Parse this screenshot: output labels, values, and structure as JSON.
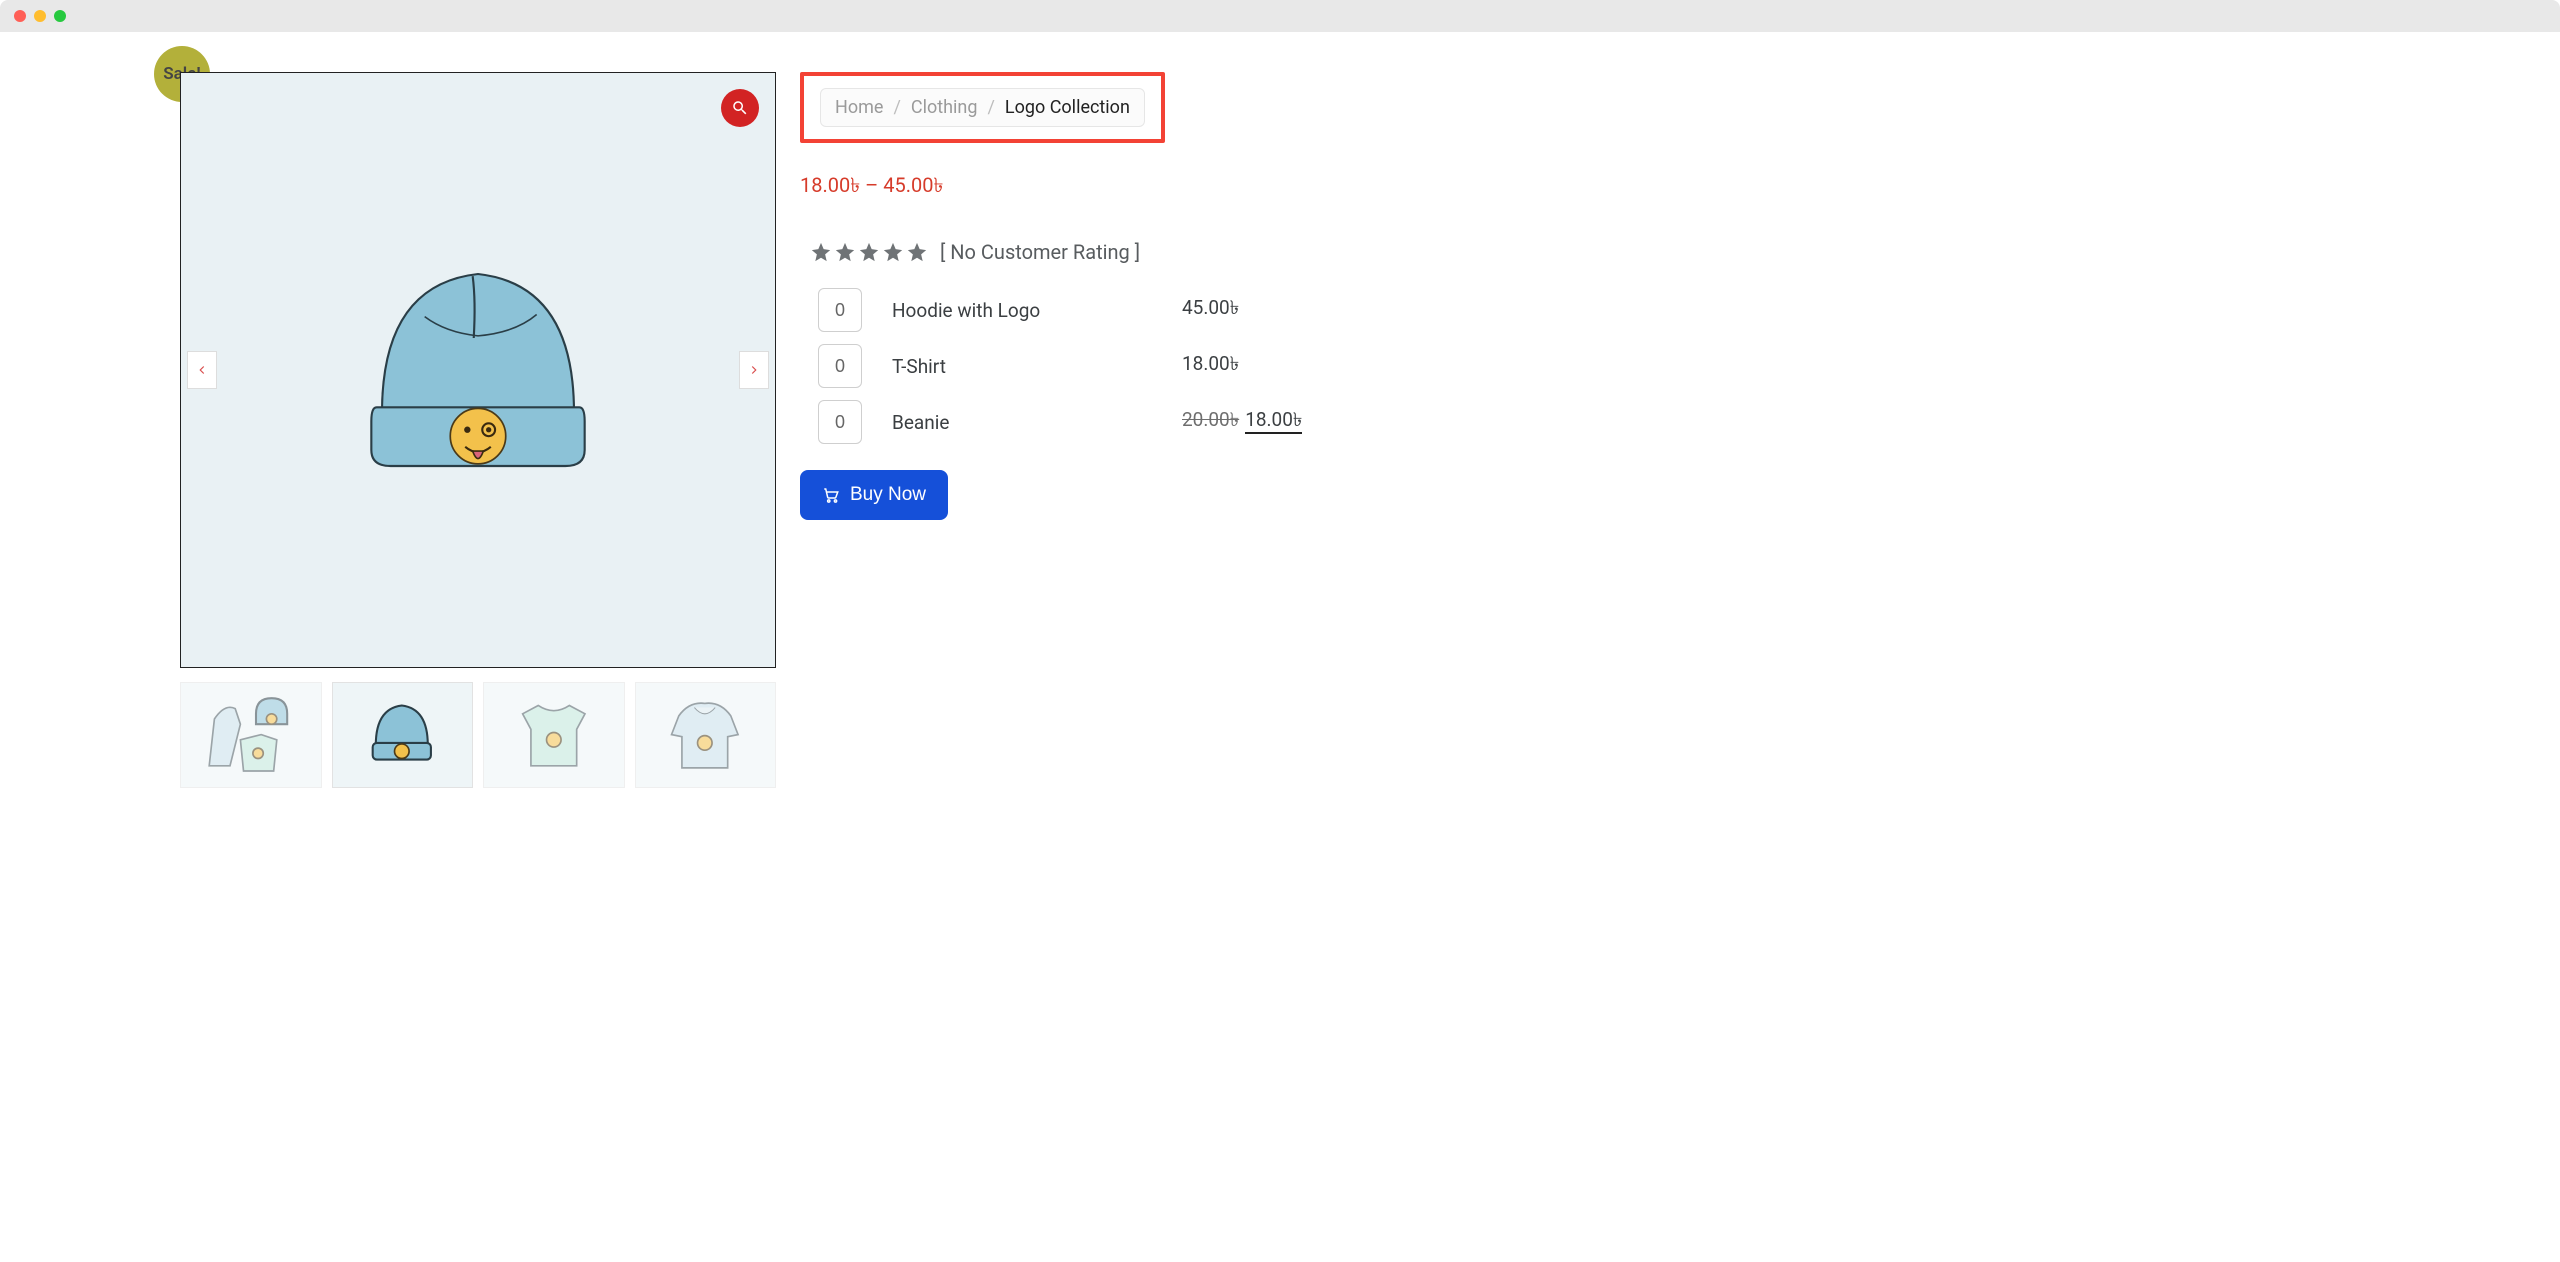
{
  "sale_badge": "Sale!",
  "breadcrumb": {
    "home": "Home",
    "clothing": "Clothing",
    "current": "Logo Collection"
  },
  "price_range": "18.00৳  – 45.00৳",
  "rating_text": "[ No Customer Rating ]",
  "variants": [
    {
      "qty": "0",
      "name": "Hoodie with Logo",
      "price": "45.00৳"
    },
    {
      "qty": "0",
      "name": "T-Shirt",
      "price": "18.00৳"
    },
    {
      "qty": "0",
      "name": "Beanie",
      "original": "20.00৳",
      "price": "18.00৳"
    }
  ],
  "buy_label": "Buy Now"
}
